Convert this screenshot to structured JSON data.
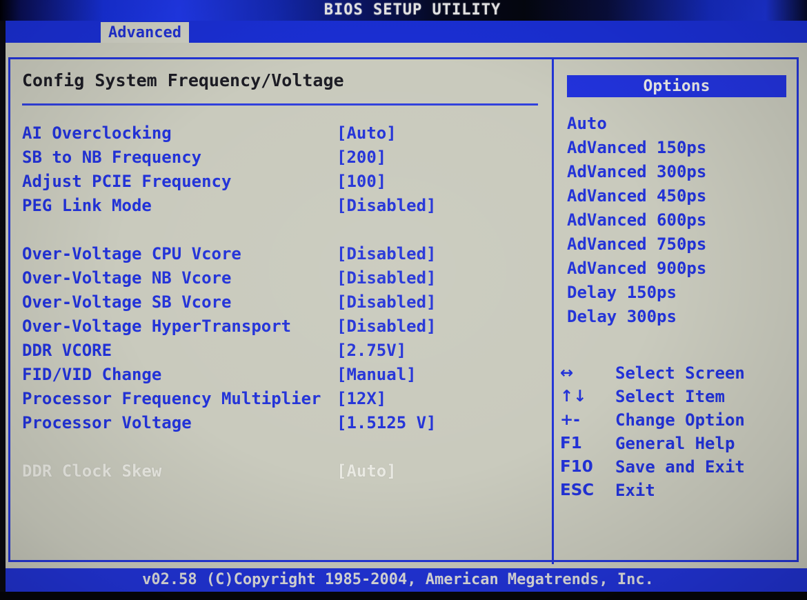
{
  "window": {
    "title": "BIOS SETUP UTILITY"
  },
  "tabs": [
    {
      "label": "Advanced",
      "active": true
    }
  ],
  "main": {
    "page_title": "Config System Frequency/Voltage",
    "settings": [
      {
        "label": "AI Overclocking",
        "value": "[Auto]",
        "dim": false,
        "gap_before": false
      },
      {
        "label": "SB to NB Frequency",
        "value": "[200]",
        "dim": false,
        "gap_before": false
      },
      {
        "label": "Adjust PCIE Frequency",
        "value": "[100]",
        "dim": false,
        "gap_before": false
      },
      {
        "label": "PEG Link Mode",
        "value": "[Disabled]",
        "dim": false,
        "gap_before": false
      },
      {
        "label": "Over-Voltage CPU Vcore",
        "value": "[Disabled]",
        "dim": false,
        "gap_before": true
      },
      {
        "label": "Over-Voltage NB Vcore",
        "value": "[Disabled]",
        "dim": false,
        "gap_before": false
      },
      {
        "label": "Over-Voltage SB Vcore",
        "value": "[Disabled]",
        "dim": false,
        "gap_before": false
      },
      {
        "label": "Over-Voltage HyperTransport",
        "value": "[Disabled]",
        "dim": false,
        "gap_before": false
      },
      {
        "label": "DDR VCORE",
        "value": "[2.75V]",
        "dim": false,
        "gap_before": false
      },
      {
        "label": "FID/VID Change",
        "value": "[Manual]",
        "dim": false,
        "gap_before": false
      },
      {
        "label": "Processor Frequency Multiplier",
        "value": "[12X]",
        "dim": false,
        "gap_before": false
      },
      {
        "label": "Processor Voltage",
        "value": "[1.5125 V]",
        "dim": false,
        "gap_before": false
      },
      {
        "label": "DDR Clock Skew",
        "value": "[Auto]",
        "dim": true,
        "gap_before": true
      }
    ]
  },
  "options_panel": {
    "header": "Options",
    "items": [
      "Auto",
      "AdVanced 150ps",
      "AdVanced 300ps",
      "AdVanced 450ps",
      "AdVanced 600ps",
      "AdVanced 750ps",
      "AdVanced 900ps",
      "Delay 150ps",
      "Delay 300ps"
    ]
  },
  "key_help": [
    {
      "glyph": "↔",
      "icon": "left-right-arrow-icon",
      "label": "Select Screen"
    },
    {
      "glyph": "↑↓",
      "icon": "up-down-arrow-icon",
      "label": "Select Item"
    },
    {
      "glyph": "+-",
      "icon": "plus-minus-icon",
      "label": "Change Option"
    },
    {
      "glyph": "F1",
      "icon": "f1-key-icon",
      "label": "General Help"
    },
    {
      "glyph": "F10",
      "icon": "f10-key-icon",
      "label": "Save and Exit"
    },
    {
      "glyph": "ESC",
      "icon": "esc-key-icon",
      "label": "Exit"
    }
  ],
  "footer": {
    "text": "v02.58 (C)Copyright 1985-2004, American Megatrends, Inc."
  },
  "colors": {
    "accent_blue": "#2232d8",
    "title_bar_blue": "#1a2fd4",
    "screen_background": "#c9cabd",
    "dim_text": "#e9e9e2",
    "header_text": "#e8e8e8"
  }
}
